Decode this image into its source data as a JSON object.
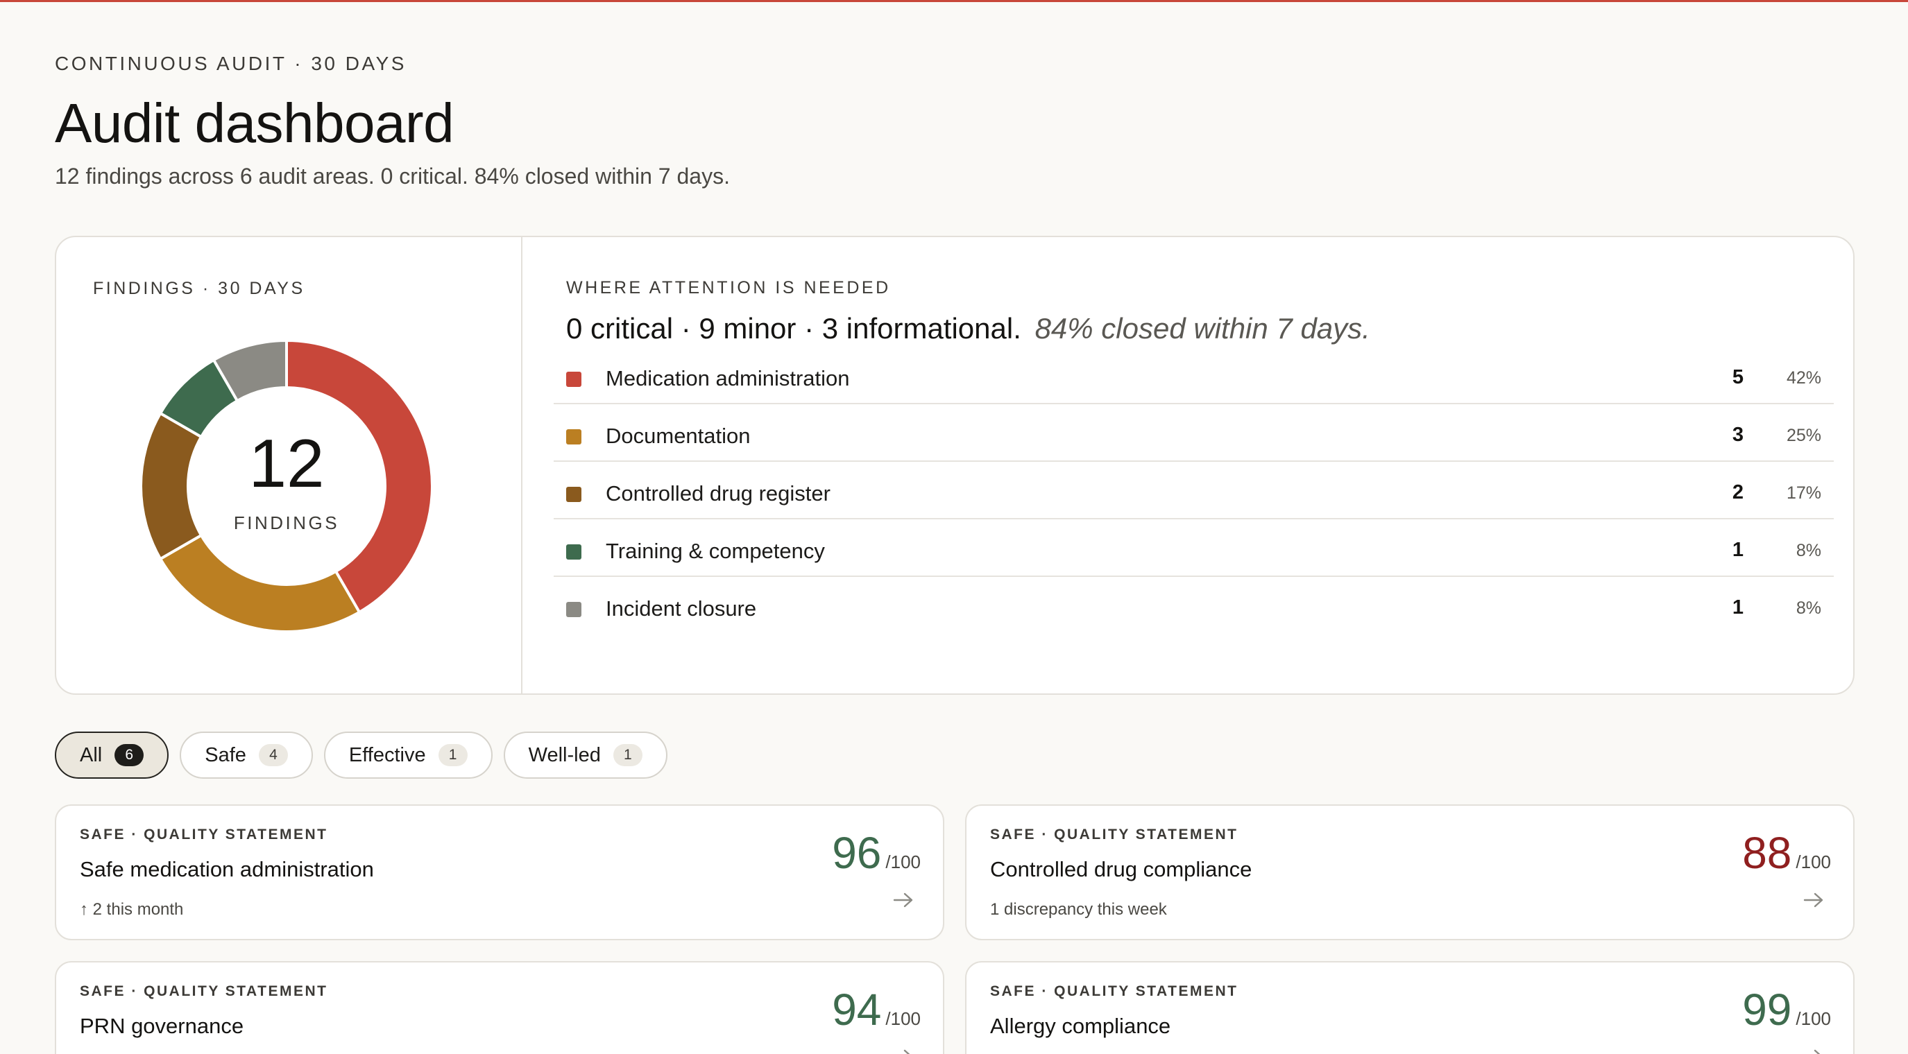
{
  "header": {
    "eyebrow": "CONTINUOUS AUDIT · 30 DAYS",
    "title": "Audit dashboard",
    "subtitle": "12 findings across 6 audit areas. 0 critical. 84% closed within 7 days."
  },
  "findings": {
    "eyebrow": "FINDINGS · 30 DAYS",
    "total": "12",
    "total_label": "FINDINGS"
  },
  "attention": {
    "eyebrow": "WHERE ATTENTION IS NEEDED",
    "headline": "0 critical · 9 minor · 3 informational.",
    "note": "84% closed within 7 days.",
    "categories": [
      {
        "label": "Medication administration",
        "count": "5",
        "pct": "42%",
        "color": "#c8473a"
      },
      {
        "label": "Documentation",
        "count": "3",
        "pct": "25%",
        "color": "#bb7f22"
      },
      {
        "label": "Controlled drug register",
        "count": "2",
        "pct": "17%",
        "color": "#8a5a1e"
      },
      {
        "label": "Training & competency",
        "count": "1",
        "pct": "8%",
        "color": "#3e6b4e"
      },
      {
        "label": "Incident closure",
        "count": "1",
        "pct": "8%",
        "color": "#8b8a84"
      }
    ]
  },
  "chart_data": {
    "type": "pie",
    "title": "",
    "categories": [
      "Medication administration",
      "Documentation",
      "Controlled drug register",
      "Training & competency",
      "Incident closure"
    ],
    "values": [
      5,
      3,
      2,
      1,
      1
    ],
    "colors": [
      "#c8473a",
      "#bb7f22",
      "#8a5a1e",
      "#3e6b4e",
      "#8b8a84"
    ]
  },
  "filters": [
    {
      "label": "All",
      "count": "6",
      "active": true
    },
    {
      "label": "Safe",
      "count": "4",
      "active": false
    },
    {
      "label": "Effective",
      "count": "1",
      "active": false
    },
    {
      "label": "Well-led",
      "count": "1",
      "active": false
    }
  ],
  "cards": [
    {
      "eyebrow": "SAFE · QUALITY STATEMENT",
      "title": "Safe medication administration",
      "note": "↑ 2 this month",
      "score": "96",
      "max": "/100",
      "score_color": "#3e6b4e"
    },
    {
      "eyebrow": "SAFE · QUALITY STATEMENT",
      "title": "Controlled drug compliance",
      "note": "1 discrepancy this week",
      "score": "88",
      "max": "/100",
      "score_color": "#8f1f1f"
    },
    {
      "eyebrow": "SAFE · QUALITY STATEMENT",
      "title": "PRN governance",
      "note": "",
      "score": "94",
      "max": "/100",
      "score_color": "#3e6b4e"
    },
    {
      "eyebrow": "SAFE · QUALITY STATEMENT",
      "title": "Allergy compliance",
      "note": "",
      "score": "99",
      "max": "/100",
      "score_color": "#3e6b4e"
    }
  ],
  "icons": {
    "card_arrow": "arrow-right-icon"
  }
}
